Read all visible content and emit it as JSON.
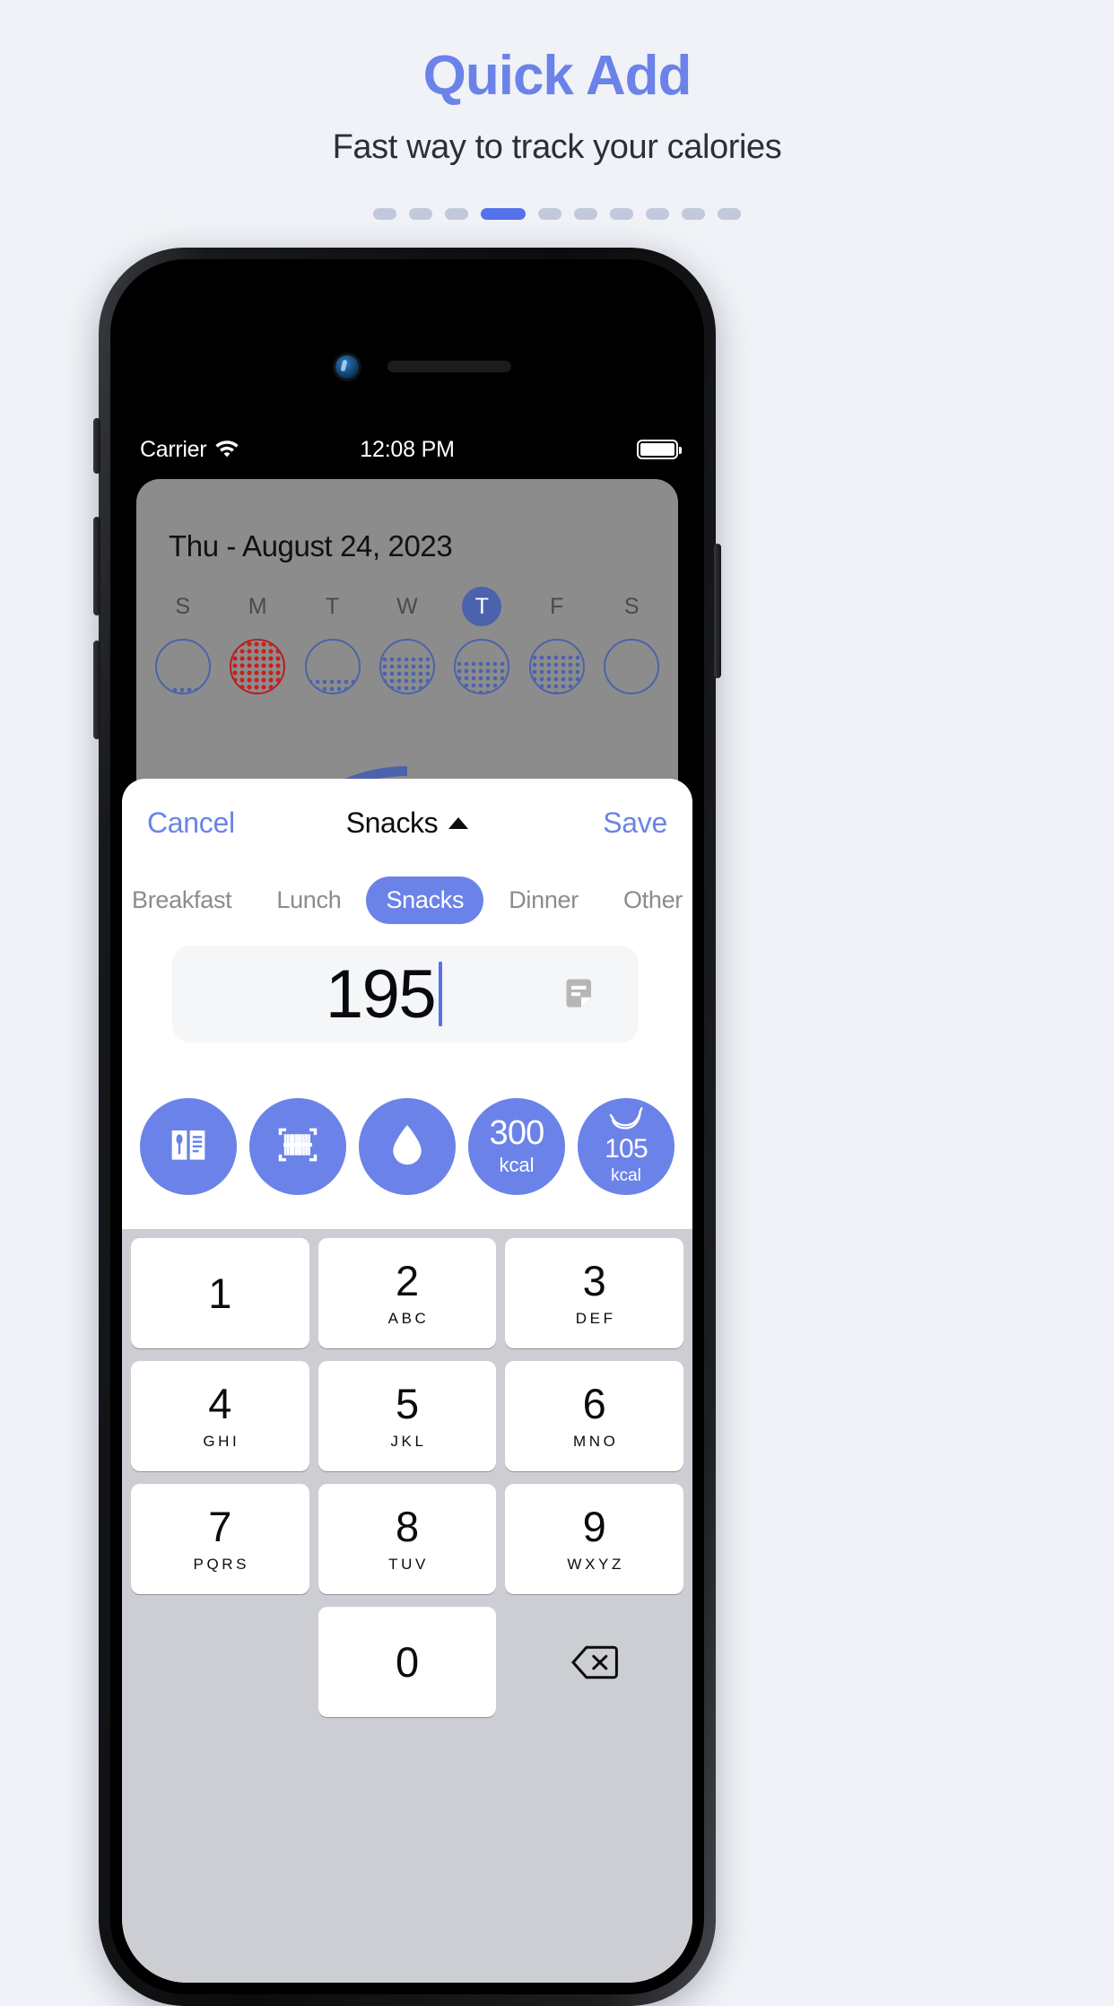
{
  "promo": {
    "title": "Quick Add",
    "subtitle": "Fast way to track your calories",
    "accent_color": "#6b83e8",
    "pager": {
      "total": 10,
      "active_index": 3
    }
  },
  "status_bar": {
    "carrier": "Carrier",
    "time": "12:08 PM",
    "wifi_icon": "wifi-icon",
    "battery_icon": "battery-full-icon"
  },
  "app": {
    "date_title": "Thu - August 24, 2023",
    "week": [
      {
        "label": "S",
        "today": false,
        "fill_pct": 12,
        "color": "blue"
      },
      {
        "label": "M",
        "today": false,
        "fill_pct": 100,
        "color": "red"
      },
      {
        "label": "T",
        "today": false,
        "fill_pct": 28,
        "color": "blue"
      },
      {
        "label": "W",
        "today": false,
        "fill_pct": 70,
        "color": "blue"
      },
      {
        "label": "T",
        "today": true,
        "fill_pct": 62,
        "color": "blue"
      },
      {
        "label": "F",
        "today": false,
        "fill_pct": 74,
        "color": "blue"
      },
      {
        "label": "S",
        "today": false,
        "fill_pct": 0,
        "color": "blue"
      }
    ]
  },
  "sheet": {
    "cancel_label": "Cancel",
    "save_label": "Save",
    "title": "Snacks",
    "meal_tabs": [
      {
        "label": "Breakfast",
        "selected": false
      },
      {
        "label": "Lunch",
        "selected": false
      },
      {
        "label": "Snacks",
        "selected": true
      },
      {
        "label": "Dinner",
        "selected": false
      },
      {
        "label": "Other",
        "selected": false
      }
    ],
    "amount_value": "195",
    "note_icon": "note-icon",
    "quick_buttons": [
      {
        "icon": "recipe-book-icon",
        "label": ""
      },
      {
        "icon": "barcode-scan-icon",
        "label": ""
      },
      {
        "icon": "water-drop-icon",
        "label": ""
      },
      {
        "icon": "",
        "value": "300",
        "unit": "kcal"
      },
      {
        "icon": "banana-icon",
        "value": "105",
        "unit": "kcal"
      }
    ]
  },
  "keypad": {
    "rows": [
      [
        {
          "num": "1",
          "letters": ""
        },
        {
          "num": "2",
          "letters": "ABC"
        },
        {
          "num": "3",
          "letters": "DEF"
        }
      ],
      [
        {
          "num": "4",
          "letters": "GHI"
        },
        {
          "num": "5",
          "letters": "JKL"
        },
        {
          "num": "6",
          "letters": "MNO"
        }
      ],
      [
        {
          "num": "7",
          "letters": "PQRS"
        },
        {
          "num": "8",
          "letters": "TUV"
        },
        {
          "num": "9",
          "letters": "WXYZ"
        }
      ],
      [
        {
          "num": "",
          "letters": ""
        },
        {
          "num": "0",
          "letters": ""
        },
        {
          "num": "",
          "letters": ""
        }
      ]
    ],
    "delete_icon": "backspace-icon"
  }
}
